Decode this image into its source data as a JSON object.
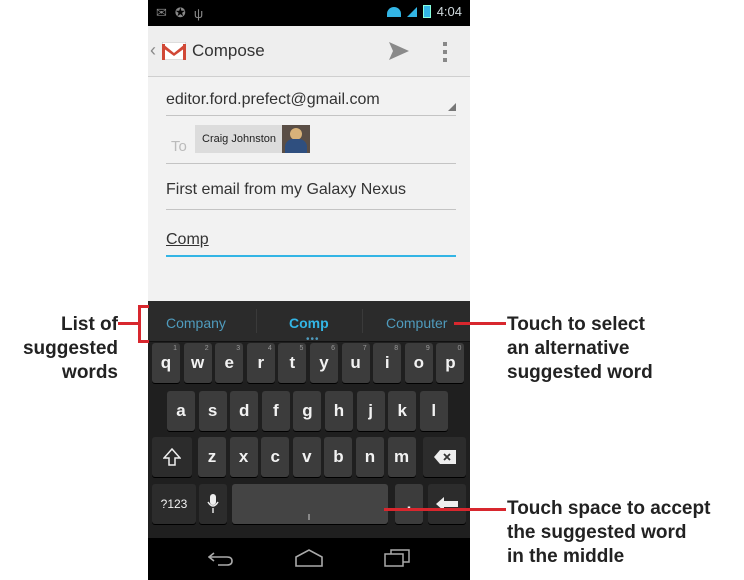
{
  "status_bar": {
    "time": "4:04"
  },
  "action_bar": {
    "title": "Compose"
  },
  "compose": {
    "from": "editor.ford.prefect@gmail.com",
    "to_label": "To",
    "recipient": "Craig Johnston",
    "subject": "First email from my Galaxy Nexus",
    "body": "Comp"
  },
  "suggestions": [
    "Company",
    "Comp",
    "Computer"
  ],
  "suggestion_dots": "•••",
  "keyboard": {
    "row1": [
      {
        "key": "q",
        "num": "1"
      },
      {
        "key": "w",
        "num": "2"
      },
      {
        "key": "e",
        "num": "3"
      },
      {
        "key": "r",
        "num": "4"
      },
      {
        "key": "t",
        "num": "5"
      },
      {
        "key": "y",
        "num": "6"
      },
      {
        "key": "u",
        "num": "7"
      },
      {
        "key": "i",
        "num": "8"
      },
      {
        "key": "o",
        "num": "9"
      },
      {
        "key": "p",
        "num": "0"
      }
    ],
    "row2": [
      "a",
      "s",
      "d",
      "f",
      "g",
      "h",
      "j",
      "k",
      "l"
    ],
    "row3": [
      "z",
      "x",
      "c",
      "v",
      "b",
      "n",
      "m"
    ],
    "symbols": "?123",
    "period": "."
  },
  "annotations": {
    "left": [
      "List of",
      "suggested",
      "words"
    ],
    "right_top": [
      "Touch to select",
      "an alternative",
      "suggested word"
    ],
    "right_bottom": [
      "Touch space to accept",
      "the suggested word",
      "in the middle"
    ]
  },
  "colors": {
    "accent": "#33b5e5",
    "callout": "#d8272e",
    "gmail_red": "#d14836"
  }
}
